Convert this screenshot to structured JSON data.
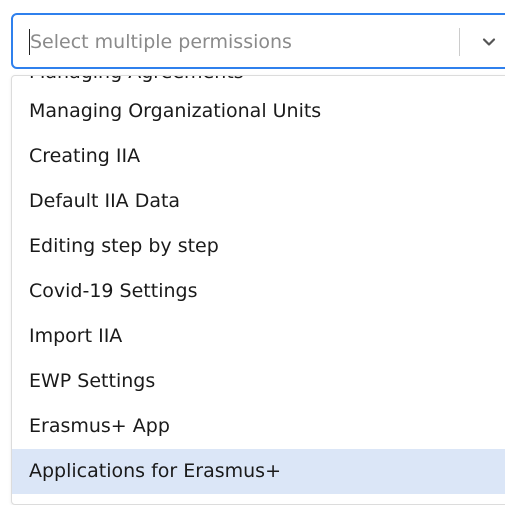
{
  "select": {
    "placeholder": "Select multiple permissions",
    "icon": "chevron-down-icon"
  },
  "menu": {
    "partial_item": "Managing Agreements",
    "items": [
      {
        "label": "Managing Organizational Units",
        "highlighted": false
      },
      {
        "label": "Creating IIA",
        "highlighted": false
      },
      {
        "label": "Default IIA Data",
        "highlighted": false
      },
      {
        "label": "Editing step by step",
        "highlighted": false
      },
      {
        "label": "Covid-19 Settings",
        "highlighted": false
      },
      {
        "label": "Import IIA",
        "highlighted": false
      },
      {
        "label": "EWP Settings",
        "highlighted": false
      },
      {
        "label": "Erasmus+ App",
        "highlighted": false
      },
      {
        "label": "Applications for Erasmus+",
        "highlighted": true
      }
    ]
  },
  "colors": {
    "focus_border": "#2f80ed",
    "highlight_bg": "#dbe6f7",
    "placeholder_text": "#8a8a8a"
  }
}
